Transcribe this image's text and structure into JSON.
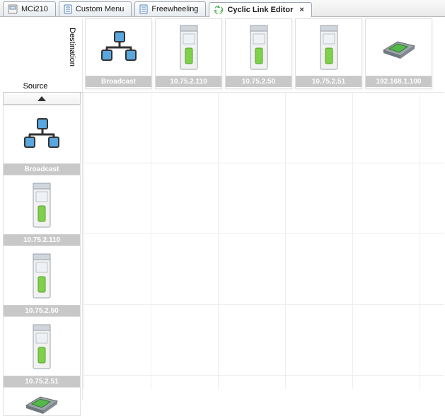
{
  "tabs": [
    {
      "label": "MCi210",
      "icon": "device-icon",
      "active": false,
      "closable": false
    },
    {
      "label": "Custom Menu",
      "icon": "document-icon",
      "active": false,
      "closable": false
    },
    {
      "label": "Freewheeling",
      "icon": "document-icon",
      "active": false,
      "closable": false
    },
    {
      "label": "Cyclic Link Editor",
      "icon": "recycle-icon",
      "active": true,
      "closable": true
    }
  ],
  "headers": {
    "destination": "Destination",
    "source": "Source"
  },
  "destinations": [
    {
      "label": "Broadcast",
      "icon": "network"
    },
    {
      "label": "10.75.2.110",
      "icon": "drive"
    },
    {
      "label": "10.75.2.50",
      "icon": "drive"
    },
    {
      "label": "10.75.2.51",
      "icon": "drive"
    },
    {
      "label": "192.168.1.100",
      "icon": "module"
    }
  ],
  "sources": [
    {
      "label": "Broadcast",
      "icon": "network"
    },
    {
      "label": "10.75.2.110",
      "icon": "drive"
    },
    {
      "label": "10.75.2.50",
      "icon": "drive"
    },
    {
      "label": "10.75.2.51",
      "icon": "drive"
    },
    {
      "label": "",
      "icon": "module"
    }
  ]
}
